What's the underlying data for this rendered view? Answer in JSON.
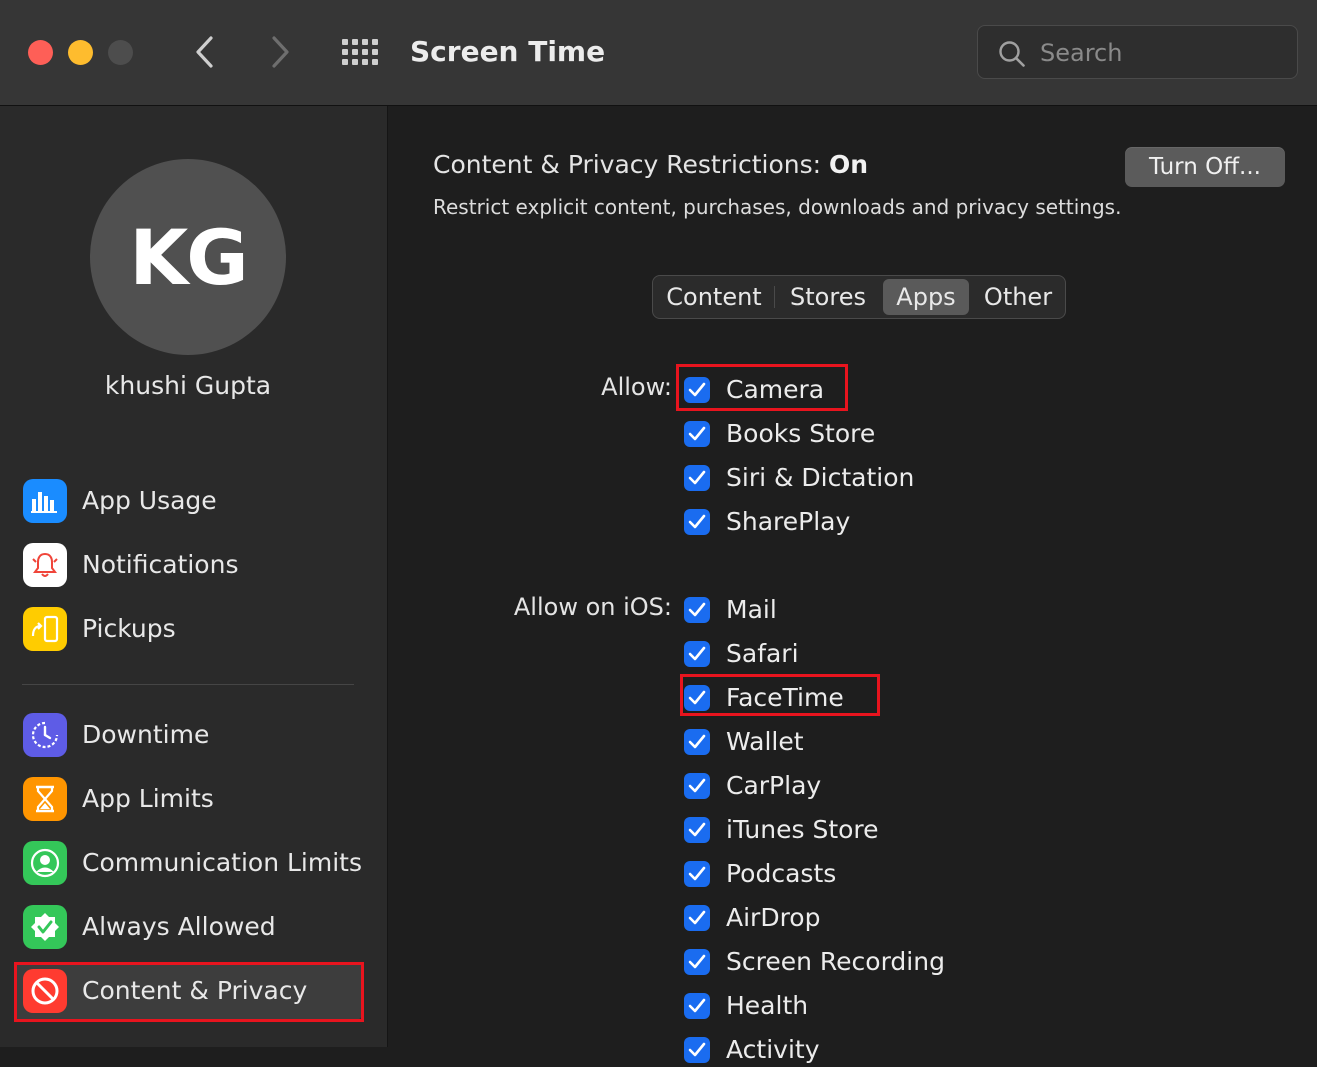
{
  "window": {
    "title": "Screen Time",
    "search": {
      "placeholder": "Search"
    }
  },
  "sidebar": {
    "user": {
      "initials": "KG",
      "name": "khushi Gupta"
    },
    "items": [
      {
        "label": "App Usage",
        "icon": "bar-chart-icon",
        "color": "#1a8cff"
      },
      {
        "label": "Notifications",
        "icon": "bell-icon",
        "color": "#ffffff"
      },
      {
        "label": "Pickups",
        "icon": "pickup-phone-icon",
        "color": "#ffcc00"
      },
      {
        "label": "Downtime",
        "icon": "moon-clock-icon",
        "color": "#5e5ce6"
      },
      {
        "label": "App Limits",
        "icon": "hourglass-icon",
        "color": "#ff9500"
      },
      {
        "label": "Communication Limits",
        "icon": "person-icon",
        "color": "#34c759"
      },
      {
        "label": "Always Allowed",
        "icon": "checkmark-badge-icon",
        "color": "#34c759"
      },
      {
        "label": "Content & Privacy",
        "icon": "prohibited-icon",
        "color": "#ff3b30"
      }
    ],
    "selected": "Content & Privacy"
  },
  "main": {
    "status_prefix": "Content & Privacy Restrictions: ",
    "status_value": "On",
    "description": "Restrict explicit content, purchases, downloads and privacy settings.",
    "turn_off_label": "Turn Off...",
    "tabs": [
      {
        "label": "Content",
        "active": false
      },
      {
        "label": "Stores",
        "active": false
      },
      {
        "label": "Apps",
        "active": true
      },
      {
        "label": "Other",
        "active": false
      }
    ],
    "allow": {
      "label": "Allow:",
      "items": [
        {
          "label": "Camera",
          "checked": true
        },
        {
          "label": "Books Store",
          "checked": true
        },
        {
          "label": "Siri & Dictation",
          "checked": true
        },
        {
          "label": "SharePlay",
          "checked": true
        }
      ]
    },
    "allow_ios": {
      "label": "Allow on iOS:",
      "items": [
        {
          "label": "Mail",
          "checked": true
        },
        {
          "label": "Safari",
          "checked": true
        },
        {
          "label": "FaceTime",
          "checked": true
        },
        {
          "label": "Wallet",
          "checked": true
        },
        {
          "label": "CarPlay",
          "checked": true
        },
        {
          "label": "iTunes Store",
          "checked": true
        },
        {
          "label": "Podcasts",
          "checked": true
        },
        {
          "label": "AirDrop",
          "checked": true
        },
        {
          "label": "Screen Recording",
          "checked": true
        },
        {
          "label": "Health",
          "checked": true
        },
        {
          "label": "Activity",
          "checked": true
        }
      ]
    }
  }
}
